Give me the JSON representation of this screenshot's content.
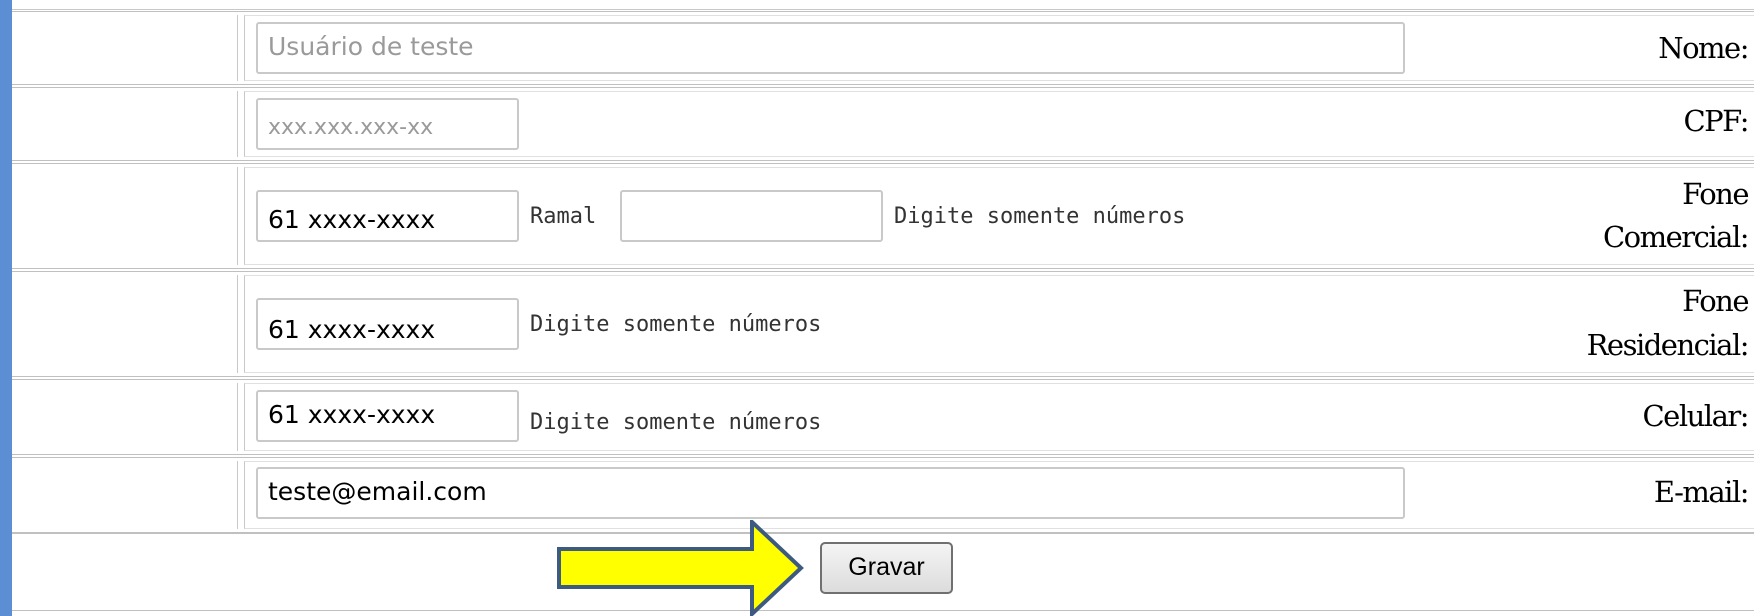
{
  "colors": {
    "accent_bar": "#5b8ed3",
    "arrow_fill": "#ffff00",
    "arrow_stroke": "#3d5a80"
  },
  "form": {
    "nome": {
      "label": "Nome:",
      "placeholder": "Usuário de teste"
    },
    "cpf": {
      "label": "CPF:",
      "placeholder": "xxx.xxx.xxx-xx"
    },
    "fone_comercial": {
      "label_line1": "Fone",
      "label_line2": "Comercial:",
      "value": "61 xxxx-xxxx",
      "ramal_label": "Ramal",
      "ramal_value": "",
      "hint": "Digite somente números"
    },
    "fone_residencial": {
      "label_line1": "Fone",
      "label_line2": "Residencial:",
      "value": "61 xxxx-xxxx",
      "hint": "Digite somente números"
    },
    "celular": {
      "label": "Celular:",
      "value": "61 xxxx-xxxx",
      "hint": "Digite somente números"
    },
    "email": {
      "label": "E-mail:",
      "value": "teste@email.com"
    },
    "save_label": "Gravar"
  },
  "annotation": {
    "icon": "arrow-right-icon"
  }
}
